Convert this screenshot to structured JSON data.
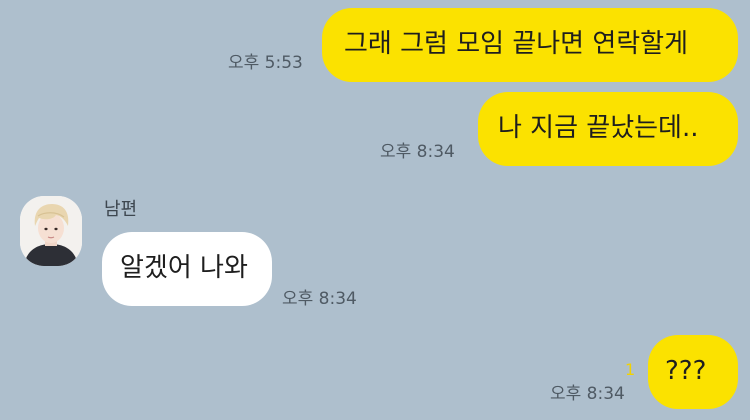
{
  "messages": [
    {
      "direction": "outgoing",
      "text": "그래 그럼 모임 끝나면 연락할게",
      "time": "오후 5:53"
    },
    {
      "direction": "outgoing",
      "text": "나 지금 끝났는데..",
      "time": "오후 8:34"
    },
    {
      "direction": "incoming",
      "sender": "남편",
      "text": "알겠어 나와",
      "time": "오후 8:34"
    },
    {
      "direction": "outgoing",
      "text": "???",
      "time": "오후 8:34",
      "unread": "1"
    }
  ],
  "colors": {
    "background": "#aebfcd",
    "outgoing_bubble": "#fbe200",
    "incoming_bubble": "#ffffff",
    "unread_count": "#f2d200"
  }
}
